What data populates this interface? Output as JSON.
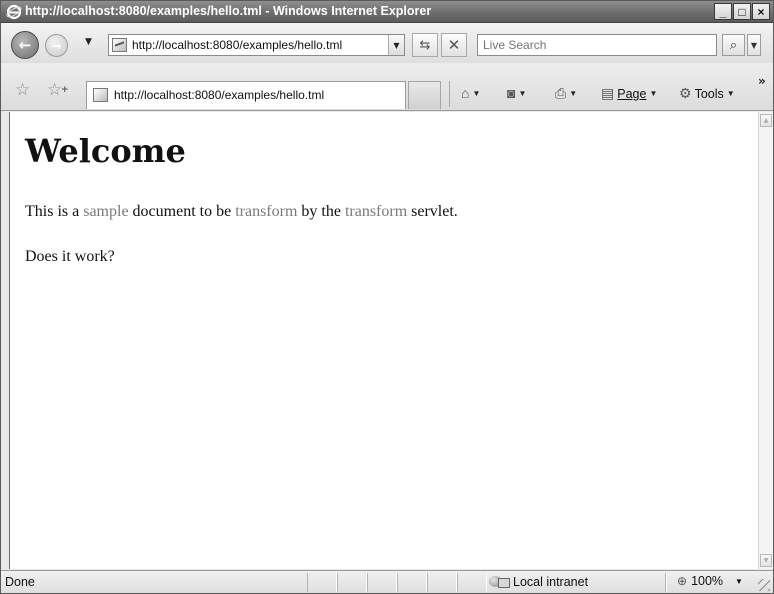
{
  "window": {
    "title": "http://localhost:8080/examples/hello.tml - Windows Internet Explorer",
    "minimize": "_",
    "maximize": "□",
    "close": "×"
  },
  "nav": {
    "back_icon": "back-arrow-icon",
    "forward_icon": "forward-arrow-icon",
    "history_dropdown": "▼",
    "address": "http://localhost:8080/examples/hello.tml",
    "address_dropdown": "▼",
    "refresh_icon": "refresh-icon",
    "stop_icon": "stop-icon",
    "search_placeholder": "Live Search",
    "search_icon": "search-icon",
    "search_dropdown": "▼"
  },
  "tabs": [
    {
      "label": "http://localhost:8080/examples/hello.tml"
    }
  ],
  "commands": {
    "page": "Page",
    "tools": "Tools",
    "more": "»"
  },
  "page": {
    "heading": "Welcome",
    "p1_before": "This is a ",
    "p1_link1": "sample",
    "p1_mid1": " document to be ",
    "p1_link2": "transform",
    "p1_mid2": " by the ",
    "p1_link3": "transform",
    "p1_after": " servlet.",
    "p2": "Does it work?"
  },
  "status": {
    "text": "Done",
    "zone": "Local intranet",
    "zoom": "100%"
  },
  "colors": {
    "link": "#7a7a7a",
    "titlebar": "#6d6d6d"
  }
}
